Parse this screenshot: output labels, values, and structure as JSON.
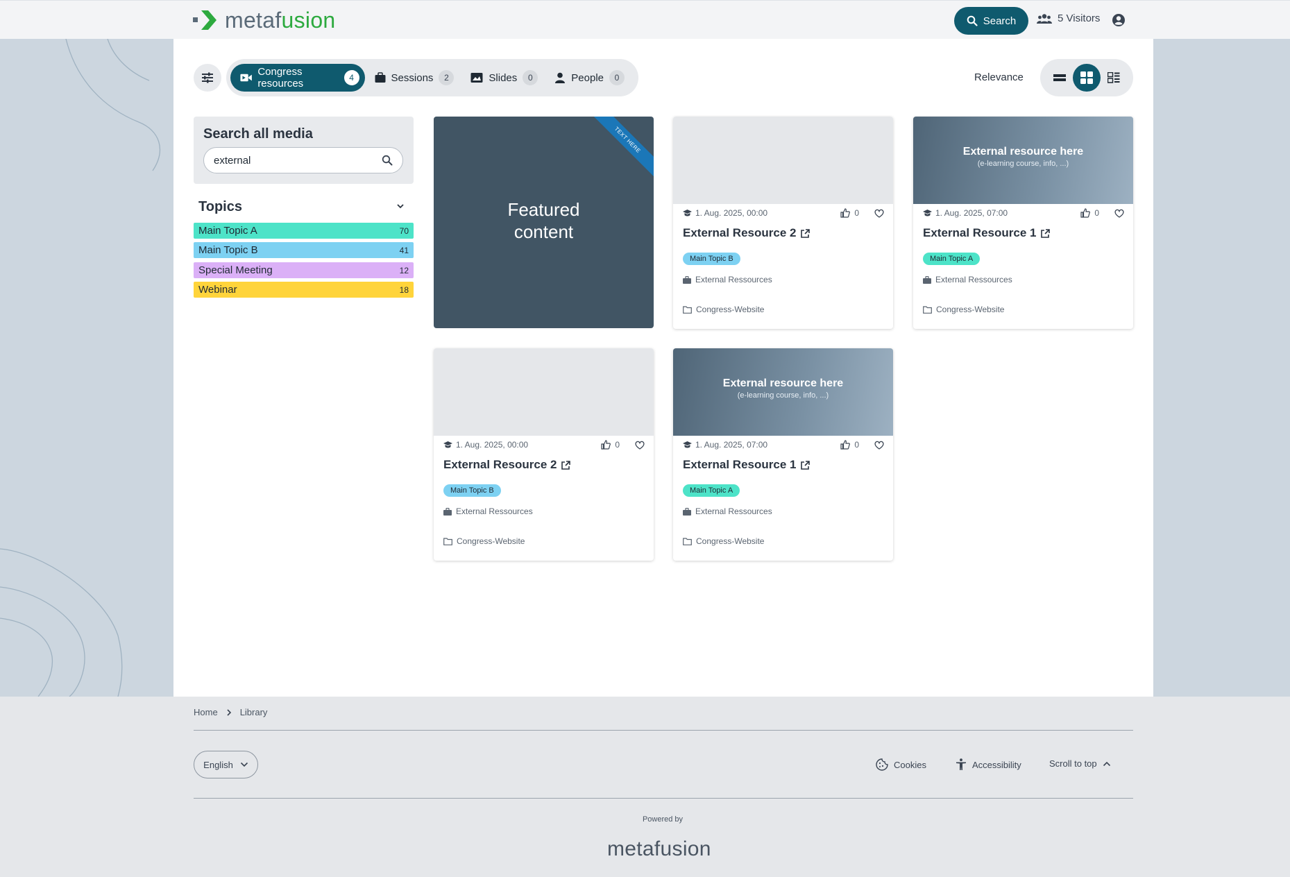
{
  "header": {
    "logo_part1": "metaf",
    "logo_part2": "usion",
    "search_label": "Search",
    "visitors_label": "5 Visitors",
    "brand_color": "#0f5a6e",
    "logo_green": "#2daa3f"
  },
  "tabs": [
    {
      "label": "Congress resources",
      "count": "4",
      "icon": "video-icon"
    },
    {
      "label": "Sessions",
      "count": "2",
      "icon": "briefcase-icon"
    },
    {
      "label": "Slides",
      "count": "0",
      "icon": "slides-icon"
    },
    {
      "label": "People",
      "count": "0",
      "icon": "person-icon"
    }
  ],
  "sort_label": "Relevance",
  "sidebar": {
    "search_title": "Search all media",
    "search_value": "external",
    "topics_title": "Topics",
    "topics": [
      {
        "label": "Main Topic A",
        "count": "70",
        "color": "#4de3c8"
      },
      {
        "label": "Main Topic B",
        "count": "41",
        "color": "#7dd1f2"
      },
      {
        "label": "Special Meeting",
        "count": "12",
        "color": "#dbb0f7"
      },
      {
        "label": "Webinar",
        "count": "18",
        "color": "#ffd43b"
      }
    ]
  },
  "featured": {
    "line1": "Featured",
    "line2": "content",
    "ribbon": "TEXT HERE"
  },
  "ext_thumb": {
    "line1": "External resource here",
    "line2": "(e-learning course, info, ...)"
  },
  "cards": [
    {
      "date": "1. Aug. 2025, 00:00",
      "likes": "0",
      "title": "External Resource 2",
      "tag": "Main Topic B",
      "tag_color": "#7dd1f2",
      "session": "External Ressources",
      "folder": "Congress-Website"
    },
    {
      "date": "1. Aug. 2025, 07:00",
      "likes": "0",
      "title": "External Resource 1",
      "tag": "Main Topic A",
      "tag_color": "#4de3c8",
      "session": "External Ressources",
      "folder": "Congress-Website"
    },
    {
      "date": "1. Aug. 2025, 00:00",
      "likes": "0",
      "title": "External Resource 2",
      "tag": "Main Topic B",
      "tag_color": "#7dd1f2",
      "session": "External Ressources",
      "folder": "Congress-Website"
    },
    {
      "date": "1. Aug. 2025, 07:00",
      "likes": "0",
      "title": "External Resource 1",
      "tag": "Main Topic A",
      "tag_color": "#4de3c8",
      "session": "External Ressources",
      "folder": "Congress-Website"
    }
  ],
  "footer": {
    "breadcrumb_home": "Home",
    "breadcrumb_current": "Library",
    "language": "English",
    "cookies": "Cookies",
    "accessibility": "Accessibility",
    "scroll_top": "Scroll to top",
    "powered_by": "Powered by",
    "logo": "metafusion"
  }
}
